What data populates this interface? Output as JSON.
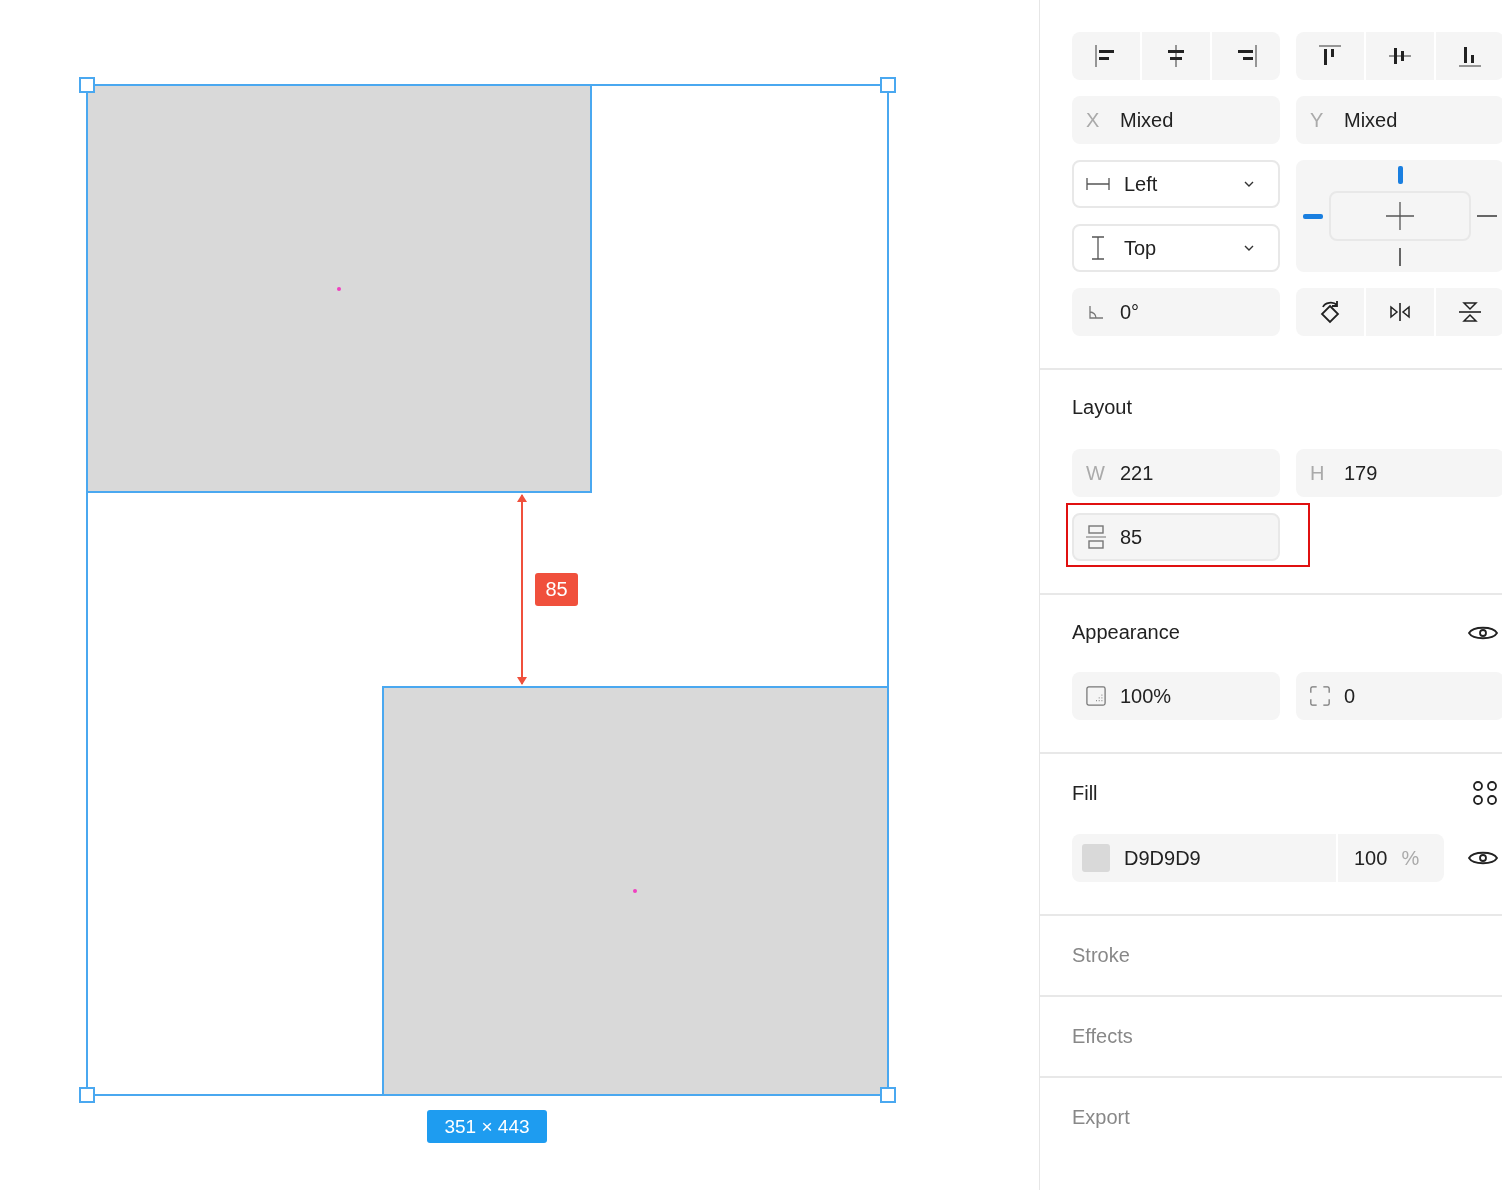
{
  "canvas": {
    "gap_label": "85",
    "size_label": "351 × 443"
  },
  "panel": {
    "position": {
      "x": {
        "label": "X",
        "value": "Mixed"
      },
      "y": {
        "label": "Y",
        "value": "Mixed"
      }
    },
    "constraints": {
      "horizontal": "Left",
      "vertical": "Top",
      "left": true,
      "top": true,
      "right": false,
      "bottom": false
    },
    "rotation": "0°",
    "layout": {
      "title": "Layout",
      "width": {
        "label": "W",
        "value": "221"
      },
      "height": {
        "label": "H",
        "value": "179"
      },
      "gap": {
        "value": "85",
        "highlighted": true
      }
    },
    "appearance": {
      "title": "Appearance",
      "opacity": "100%",
      "radius": "0"
    },
    "fill": {
      "title": "Fill",
      "hex": "D9D9D9",
      "color": "#d9d9d9",
      "opacity": "100",
      "unit": "%"
    },
    "collapsed_sections": [
      "Stroke",
      "Effects",
      "Export"
    ]
  }
}
